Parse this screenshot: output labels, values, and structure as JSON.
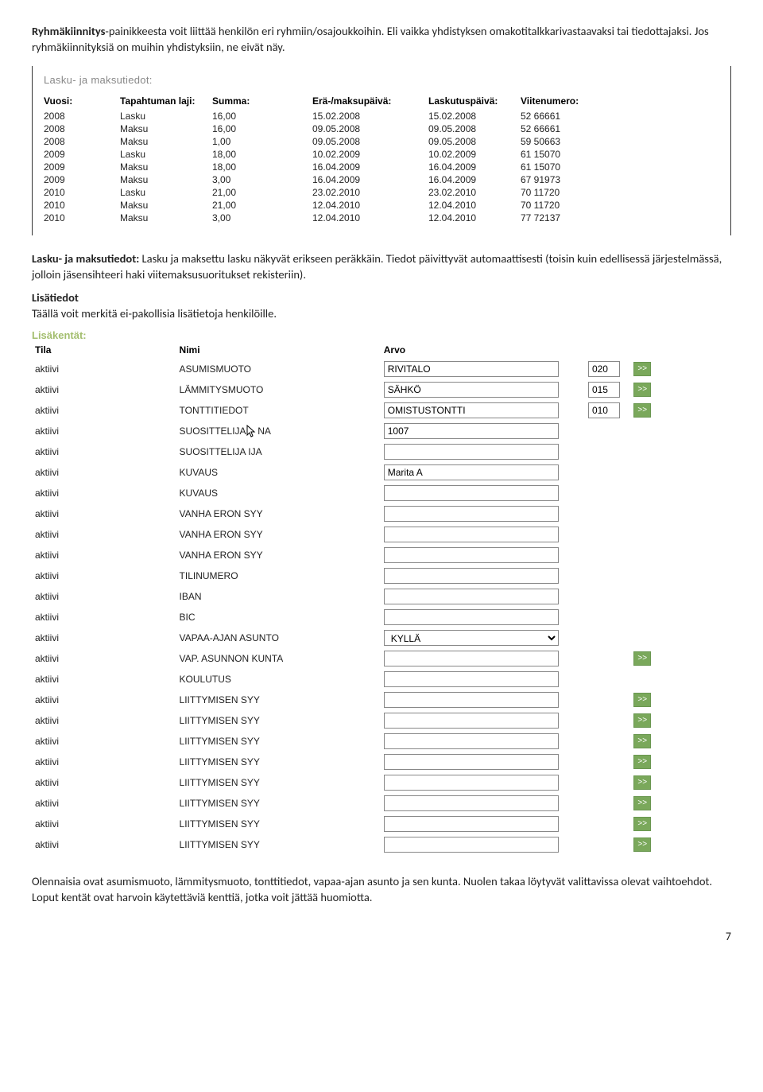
{
  "intro": {
    "p1_prefix": "Ryhmäkiinnitys",
    "p1_rest": "-painikkeesta voit liittää henkilön eri ryhmiin/osajoukkoihin. Eli vaikka yhdistyksen omakotitalkkarivastaavaksi tai tiedottajaksi. Jos ryhmäkiinnityksiä on muihin yhdistyksiin, ne eivät näy."
  },
  "payments": {
    "panel_title": "Lasku- ja maksutiedot:",
    "headers": {
      "vuosi": "Vuosi:",
      "laji": "Tapahtuman laji:",
      "summa": "Summa:",
      "era": "Erä-/maksupäivä:",
      "lpv": "Laskutuspäivä:",
      "viite": "Viitenumero:"
    },
    "rows": [
      {
        "vuosi": "2008",
        "laji": "Lasku",
        "summa": "16,00",
        "era": "15.02.2008",
        "lpv": "15.02.2008",
        "viite": "52 66661"
      },
      {
        "vuosi": "2008",
        "laji": "Maksu",
        "summa": "16,00",
        "era": "09.05.2008",
        "lpv": "09.05.2008",
        "viite": "52 66661"
      },
      {
        "vuosi": "2008",
        "laji": "Maksu",
        "summa": "1,00",
        "era": "09.05.2008",
        "lpv": "09.05.2008",
        "viite": "59 50663"
      },
      {
        "vuosi": "2009",
        "laji": "Lasku",
        "summa": "18,00",
        "era": "10.02.2009",
        "lpv": "10.02.2009",
        "viite": "61 15070"
      },
      {
        "vuosi": "2009",
        "laji": "Maksu",
        "summa": "18,00",
        "era": "16.04.2009",
        "lpv": "16.04.2009",
        "viite": "61 15070"
      },
      {
        "vuosi": "2009",
        "laji": "Maksu",
        "summa": "3,00",
        "era": "16.04.2009",
        "lpv": "16.04.2009",
        "viite": "67 91973"
      },
      {
        "vuosi": "2010",
        "laji": "Lasku",
        "summa": "21,00",
        "era": "23.02.2010",
        "lpv": "23.02.2010",
        "viite": "70 11720"
      },
      {
        "vuosi": "2010",
        "laji": "Maksu",
        "summa": "21,00",
        "era": "12.04.2010",
        "lpv": "12.04.2010",
        "viite": "70 11720"
      },
      {
        "vuosi": "2010",
        "laji": "Maksu",
        "summa": "3,00",
        "era": "12.04.2010",
        "lpv": "12.04.2010",
        "viite": "77 72137"
      }
    ]
  },
  "mid": {
    "p2_bold": "Lasku- ja maksutiedot:",
    "p2_rest": " Lasku ja maksettu lasku näkyvät erikseen peräkkäin. Tiedot päivittyvät automaattisesti (toisin kuin edellisessä järjestelmässä, jolloin jäsensihteeri haki viitemaksusuoritukset rekisteriin).",
    "p3_bold": "Lisätiedot",
    "p3_rest": "Täällä voit merkitä ei-pakollisia lisätietoja henkilöille."
  },
  "lisa": {
    "title": "Lisäkentät:",
    "headers": {
      "tila": "Tila",
      "nimi": "Nimi",
      "arvo": "Arvo"
    },
    "rows": [
      {
        "tila": "aktiivi",
        "nimi": "ASUMISMUOTO",
        "arvo": "RIVITALO",
        "code": "020",
        "btn": true,
        "cursor": false,
        "select": false
      },
      {
        "tila": "aktiivi",
        "nimi": "LÄMMITYSMUOTO",
        "arvo": "SÄHKÖ",
        "code": "015",
        "btn": true,
        "cursor": false,
        "select": false
      },
      {
        "tila": "aktiivi",
        "nimi": "TONTTITIEDOT",
        "arvo": "OMISTUSTONTTI",
        "code": "010",
        "btn": true,
        "cursor": false,
        "select": false
      },
      {
        "tila": "aktiivi",
        "nimi": "SUOSITTELIJA",
        "trail": "NA",
        "arvo": "1007",
        "code": "",
        "btn": false,
        "cursor": true,
        "select": false
      },
      {
        "tila": "aktiivi",
        "nimi": "SUOSITTELIJA IJA",
        "arvo": "",
        "code": "",
        "btn": false,
        "cursor": false,
        "select": false
      },
      {
        "tila": "aktiivi",
        "nimi": "KUVAUS",
        "arvo": "Marita A",
        "code": "",
        "btn": false,
        "cursor": false,
        "select": false
      },
      {
        "tila": "aktiivi",
        "nimi": "KUVAUS",
        "arvo": "",
        "code": "",
        "btn": false,
        "cursor": false,
        "select": false
      },
      {
        "tila": "aktiivi",
        "nimi": "VANHA ERON SYY",
        "arvo": "",
        "code": "",
        "btn": false,
        "cursor": false,
        "select": false
      },
      {
        "tila": "aktiivi",
        "nimi": "VANHA ERON SYY",
        "arvo": "",
        "code": "",
        "btn": false,
        "cursor": false,
        "select": false
      },
      {
        "tila": "aktiivi",
        "nimi": "VANHA ERON SYY",
        "arvo": "",
        "code": "",
        "btn": false,
        "cursor": false,
        "select": false
      },
      {
        "tila": "aktiivi",
        "nimi": "TILINUMERO",
        "arvo": "",
        "code": "",
        "btn": false,
        "cursor": false,
        "select": false
      },
      {
        "tila": "aktiivi",
        "nimi": "IBAN",
        "arvo": "",
        "code": "",
        "btn": false,
        "cursor": false,
        "select": false
      },
      {
        "tila": "aktiivi",
        "nimi": "BIC",
        "arvo": "",
        "code": "",
        "btn": false,
        "cursor": false,
        "select": false
      },
      {
        "tila": "aktiivi",
        "nimi": "VAPAA-AJAN ASUNTO",
        "arvo": "KYLLÄ",
        "code": "",
        "btn": false,
        "cursor": false,
        "select": true
      },
      {
        "tila": "aktiivi",
        "nimi": "VAP. ASUNNON KUNTA",
        "arvo": "",
        "code": "",
        "btn": true,
        "cursor": false,
        "select": false
      },
      {
        "tila": "aktiivi",
        "nimi": "KOULUTUS",
        "arvo": "",
        "code": "",
        "btn": false,
        "cursor": false,
        "select": false
      },
      {
        "tila": "aktiivi",
        "nimi": "LIITTYMISEN SYY",
        "arvo": "",
        "code": "",
        "btn": true,
        "cursor": false,
        "select": false
      },
      {
        "tila": "aktiivi",
        "nimi": "LIITTYMISEN SYY",
        "arvo": "",
        "code": "",
        "btn": true,
        "cursor": false,
        "select": false
      },
      {
        "tila": "aktiivi",
        "nimi": "LIITTYMISEN SYY",
        "arvo": "",
        "code": "",
        "btn": true,
        "cursor": false,
        "select": false
      },
      {
        "tila": "aktiivi",
        "nimi": "LIITTYMISEN SYY",
        "arvo": "",
        "code": "",
        "btn": true,
        "cursor": false,
        "select": false
      },
      {
        "tila": "aktiivi",
        "nimi": "LIITTYMISEN SYY",
        "arvo": "",
        "code": "",
        "btn": true,
        "cursor": false,
        "select": false
      },
      {
        "tila": "aktiivi",
        "nimi": "LIITTYMISEN SYY",
        "arvo": "",
        "code": "",
        "btn": true,
        "cursor": false,
        "select": false
      },
      {
        "tila": "aktiivi",
        "nimi": "LIITTYMISEN SYY",
        "arvo": "",
        "code": "",
        "btn": true,
        "cursor": false,
        "select": false
      },
      {
        "tila": "aktiivi",
        "nimi": "LIITTYMISEN SYY",
        "arvo": "",
        "code": "",
        "btn": true,
        "cursor": false,
        "select": false
      }
    ]
  },
  "outro": {
    "text": "Olennaisia ovat asumismuoto, lämmitysmuoto, tonttitiedot, vapaa-ajan asunto ja sen kunta. Nuolen takaa löytyvät valittavissa olevat vaihtoehdot. Loput kentät ovat harvoin käytettäviä kenttiä, jotka voit jättää huomiotta."
  },
  "page": "7",
  "go_label": ">>"
}
